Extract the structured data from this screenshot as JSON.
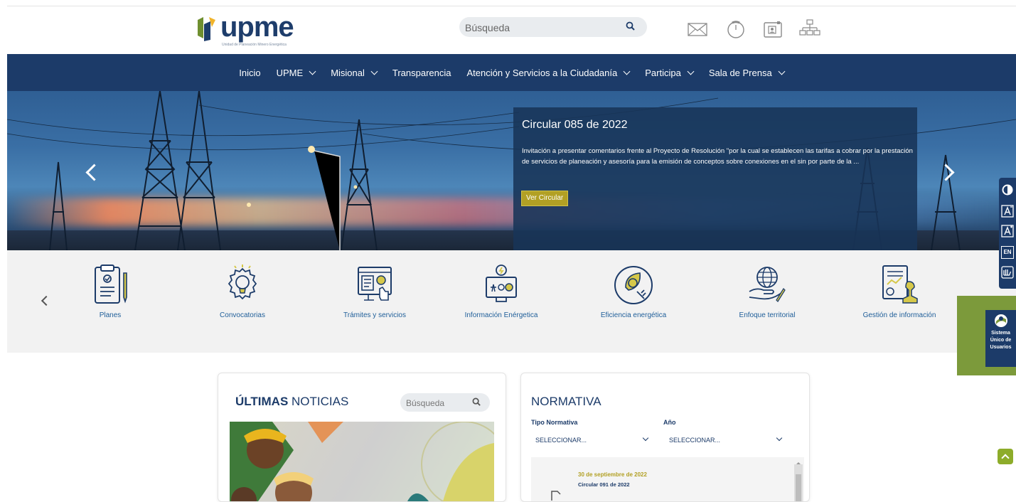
{
  "header": {
    "logo_text": "upme",
    "logo_tagline": "Unidad de Planeación Minero Energética",
    "search_placeholder": "Búsqueda",
    "icons": [
      "mail-icon",
      "clock-icon",
      "contact-card-icon",
      "sitemap-icon"
    ]
  },
  "nav": {
    "items": [
      {
        "label": "Inicio",
        "dropdown": false
      },
      {
        "label": "UPME",
        "dropdown": true
      },
      {
        "label": "Misional",
        "dropdown": true
      },
      {
        "label": "Transparencia",
        "dropdown": false
      },
      {
        "label": "Atención y Servicios a la Ciudadanía",
        "dropdown": true
      },
      {
        "label": "Participa",
        "dropdown": true
      },
      {
        "label": "Sala de Prensa",
        "dropdown": true
      }
    ]
  },
  "hero": {
    "title": "Circular 085 de 2022",
    "text": "Invitación a presentar comentarios frente al Proyecto de Resolución \"por la cual se establecen las tarifas a cobrar por la prestación de servicios de planeación y asesoría para la emisión de conceptos sobre conexiones en el sin por parte de la ...",
    "button_label": "Ver Circular"
  },
  "services": [
    {
      "label": "Planes",
      "icon": "plans-clipboard-icon"
    },
    {
      "label": "Convocatorias",
      "icon": "lightbulb-gear-icon"
    },
    {
      "label": "Trámites y servicios",
      "icon": "procedures-screen-icon"
    },
    {
      "label": "Información Enérgetica",
      "icon": "energy-info-icon"
    },
    {
      "label": "Eficiencia energética",
      "icon": "leaf-plug-icon"
    },
    {
      "label": "Enfoque territorial",
      "icon": "globe-hand-icon"
    },
    {
      "label": "Gestión de información",
      "icon": "document-stamp-icon"
    }
  ],
  "accessibility": {
    "items": [
      "contrast-icon",
      "font-decrease-icon",
      "font-increase-icon",
      "EN",
      "sign-language-icon"
    ],
    "en_label": "EN"
  },
  "suu": {
    "label": "Sistema Único de Usuarios"
  },
  "news": {
    "title_bold": "ÚLTIMAS",
    "title_rest": "NOTICIAS",
    "search_placeholder": "Búsqueda"
  },
  "normativa": {
    "title": "NORMATIVA",
    "type_label": "Tipo Normativa",
    "year_label": "Año",
    "type_value": "SELECCIONAR...",
    "year_value": "SELECCIONAR...",
    "first_date": "30 de septiembre de 2022",
    "first_doc": "Circular 091 de 2022"
  },
  "colors": {
    "navy": "#1c3b69",
    "olive": "#b2a024",
    "green": "#7c9a3b",
    "link_blue": "#1f5e99"
  }
}
